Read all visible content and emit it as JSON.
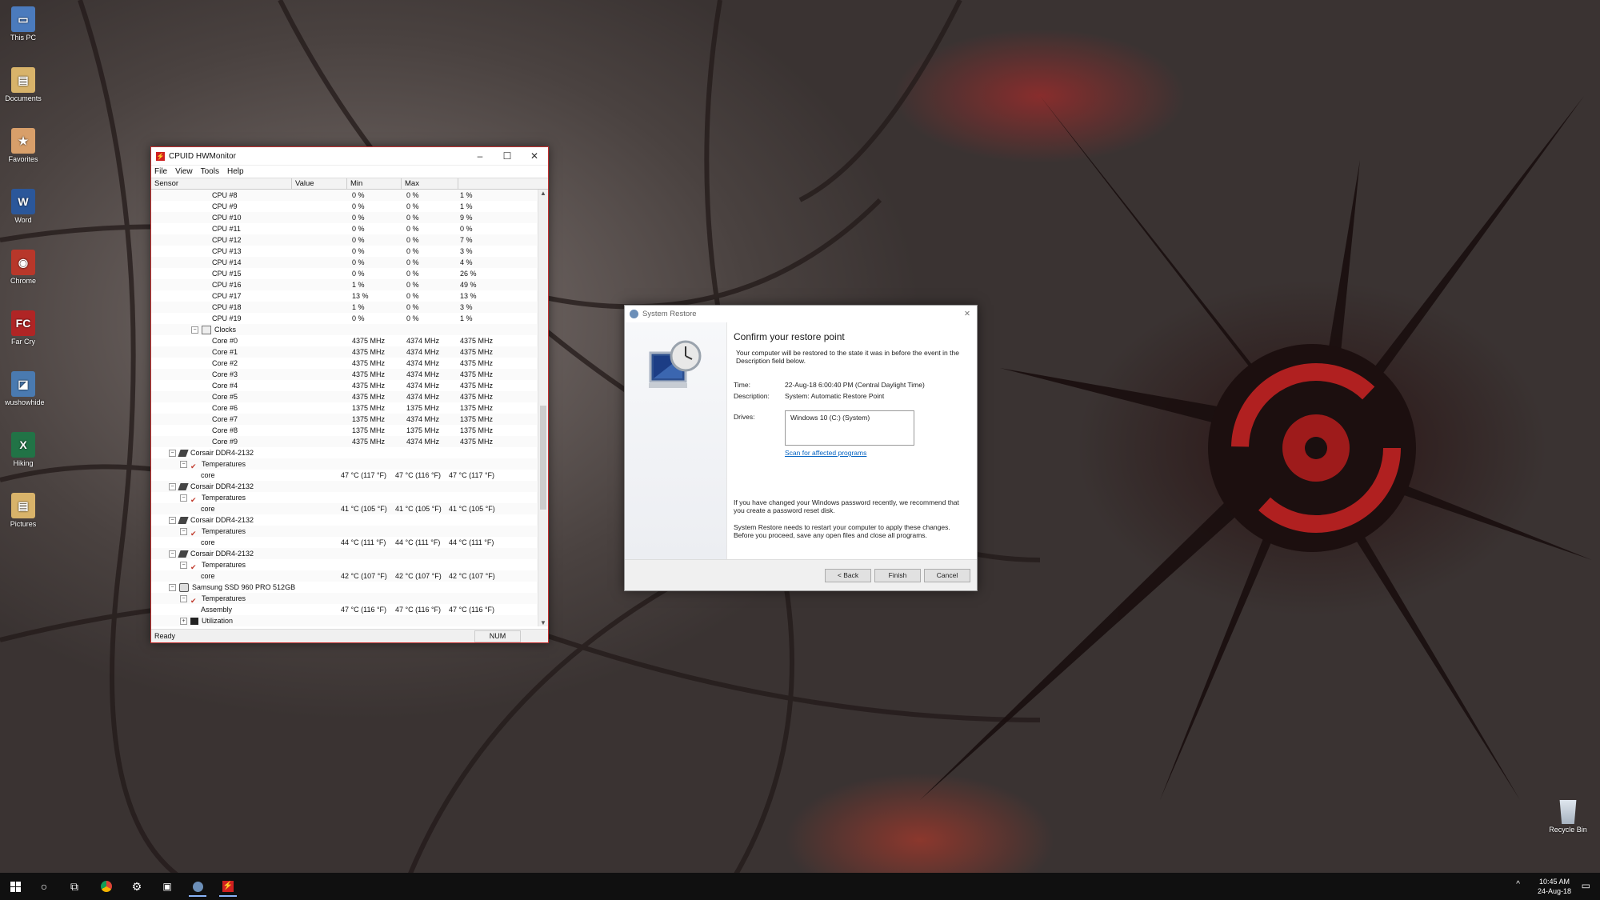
{
  "desktop": {
    "icons": [
      {
        "label": "This PC",
        "icon": "computer-icon",
        "color": "#4b7bbd",
        "glyph": "▭"
      },
      {
        "label": "Documents",
        "icon": "folder-icon",
        "color": "#d8b36a",
        "glyph": "▤"
      },
      {
        "label": "Favorites",
        "icon": "favorites-folder-icon",
        "color": "#d89f6a",
        "glyph": "★"
      },
      {
        "label": "Word",
        "icon": "word-icon",
        "color": "#2b579a",
        "glyph": "W"
      },
      {
        "label": "Chrome",
        "icon": "chrome-icon",
        "color": "#b8372a",
        "glyph": "◉"
      },
      {
        "label": "Far Cry",
        "icon": "farcry-icon",
        "color": "#b02525",
        "glyph": "FC"
      },
      {
        "label": "wushowhide",
        "icon": "troubleshooter-icon",
        "color": "#4a7ab0",
        "glyph": "◪"
      },
      {
        "label": "Hiking",
        "icon": "excel-icon",
        "color": "#217346",
        "glyph": "X"
      },
      {
        "label": "Pictures",
        "icon": "folder-icon",
        "color": "#d8b36a",
        "glyph": "▤"
      }
    ],
    "recycle_bin": "Recycle Bin"
  },
  "hwmonitor": {
    "title": "CPUID HWMonitor",
    "menu": [
      "File",
      "View",
      "Tools",
      "Help"
    ],
    "columns": [
      "Sensor",
      "Value",
      "Min",
      "Max"
    ],
    "status": "Ready",
    "status_num": "NUM",
    "rows": [
      {
        "indent": 3,
        "name": "CPU #8",
        "value": "0 %",
        "min": "0 %",
        "max": "1 %"
      },
      {
        "indent": 3,
        "name": "CPU #9",
        "value": "0 %",
        "min": "0 %",
        "max": "1 %"
      },
      {
        "indent": 3,
        "name": "CPU #10",
        "value": "0 %",
        "min": "0 %",
        "max": "9 %"
      },
      {
        "indent": 3,
        "name": "CPU #11",
        "value": "0 %",
        "min": "0 %",
        "max": "0 %"
      },
      {
        "indent": 3,
        "name": "CPU #12",
        "value": "0 %",
        "min": "0 %",
        "max": "7 %"
      },
      {
        "indent": 3,
        "name": "CPU #13",
        "value": "0 %",
        "min": "0 %",
        "max": "3 %"
      },
      {
        "indent": 3,
        "name": "CPU #14",
        "value": "0 %",
        "min": "0 %",
        "max": "4 %"
      },
      {
        "indent": 3,
        "name": "CPU #15",
        "value": "0 %",
        "min": "0 %",
        "max": "26 %"
      },
      {
        "indent": 3,
        "name": "CPU #16",
        "value": "1 %",
        "min": "0 %",
        "max": "49 %"
      },
      {
        "indent": 3,
        "name": "CPU #17",
        "value": "13 %",
        "min": "0 %",
        "max": "13 %"
      },
      {
        "indent": 3,
        "name": "CPU #18",
        "value": "1 %",
        "min": "0 %",
        "max": "3 %"
      },
      {
        "indent": 3,
        "name": "CPU #19",
        "value": "0 %",
        "min": "0 %",
        "max": "1 %"
      },
      {
        "indent": 2,
        "name": "Clocks",
        "toggle": "−",
        "icon": "clock-sensor",
        "value": "",
        "min": "",
        "max": ""
      },
      {
        "indent": 3,
        "name": "Core #0",
        "value": "4375 MHz",
        "min": "4374 MHz",
        "max": "4375 MHz"
      },
      {
        "indent": 3,
        "name": "Core #1",
        "value": "4375 MHz",
        "min": "4374 MHz",
        "max": "4375 MHz"
      },
      {
        "indent": 3,
        "name": "Core #2",
        "value": "4375 MHz",
        "min": "4374 MHz",
        "max": "4375 MHz"
      },
      {
        "indent": 3,
        "name": "Core #3",
        "value": "4375 MHz",
        "min": "4374 MHz",
        "max": "4375 MHz"
      },
      {
        "indent": 3,
        "name": "Core #4",
        "value": "4375 MHz",
        "min": "4374 MHz",
        "max": "4375 MHz"
      },
      {
        "indent": 3,
        "name": "Core #5",
        "value": "4375 MHz",
        "min": "4374 MHz",
        "max": "4375 MHz"
      },
      {
        "indent": 3,
        "name": "Core #6",
        "value": "1375 MHz",
        "min": "1375 MHz",
        "max": "1375 MHz"
      },
      {
        "indent": 3,
        "name": "Core #7",
        "value": "1375 MHz",
        "min": "4374 MHz",
        "max": "1375 MHz"
      },
      {
        "indent": 3,
        "name": "Core #8",
        "value": "1375 MHz",
        "min": "1375 MHz",
        "max": "1375 MHz"
      },
      {
        "indent": 3,
        "name": "Core #9",
        "value": "4375 MHz",
        "min": "4374 MHz",
        "max": "4375 MHz"
      },
      {
        "indent": 0,
        "name": "Corsair DDR4-2132",
        "toggle": "−",
        "icon": "memory",
        "value": "",
        "min": "",
        "max": ""
      },
      {
        "indent": 1,
        "name": "Temperatures",
        "toggle": "−",
        "icon": "thermometer",
        "value": "",
        "min": "",
        "max": ""
      },
      {
        "indent": 2,
        "name": "core",
        "value": "47 °C  (117 °F)",
        "min": "47 °C  (116 °F)",
        "max": "47 °C  (117 °F)"
      },
      {
        "indent": 0,
        "name": "Corsair DDR4-2132",
        "toggle": "−",
        "icon": "memory",
        "value": "",
        "min": "",
        "max": ""
      },
      {
        "indent": 1,
        "name": "Temperatures",
        "toggle": "−",
        "icon": "thermometer",
        "value": "",
        "min": "",
        "max": ""
      },
      {
        "indent": 2,
        "name": "core",
        "value": "41 °C  (105 °F)",
        "min": "41 °C  (105 °F)",
        "max": "41 °C  (105 °F)"
      },
      {
        "indent": 0,
        "name": "Corsair DDR4-2132",
        "toggle": "−",
        "icon": "memory",
        "value": "",
        "min": "",
        "max": ""
      },
      {
        "indent": 1,
        "name": "Temperatures",
        "toggle": "−",
        "icon": "thermometer",
        "value": "",
        "min": "",
        "max": ""
      },
      {
        "indent": 2,
        "name": "core",
        "value": "44 °C  (111 °F)",
        "min": "44 °C  (111 °F)",
        "max": "44 °C  (111 °F)"
      },
      {
        "indent": 0,
        "name": "Corsair DDR4-2132",
        "toggle": "−",
        "icon": "memory",
        "value": "",
        "min": "",
        "max": ""
      },
      {
        "indent": 1,
        "name": "Temperatures",
        "toggle": "−",
        "icon": "thermometer",
        "value": "",
        "min": "",
        "max": ""
      },
      {
        "indent": 2,
        "name": "core",
        "value": "42 °C  (107 °F)",
        "min": "42 °C  (107 °F)",
        "max": "42 °C  (107 °F)"
      },
      {
        "indent": 0,
        "name": "Samsung SSD 960  PRO 512GB",
        "toggle": "−",
        "icon": "disk",
        "value": "",
        "min": "",
        "max": ""
      },
      {
        "indent": 1,
        "name": "Temperatures",
        "toggle": "−",
        "icon": "thermometer",
        "value": "",
        "min": "",
        "max": ""
      },
      {
        "indent": 2,
        "name": "Assembly",
        "value": "47 °C  (116 °F)",
        "min": "47 °C  (116 °F)",
        "max": "47 °C  (116 °F)"
      },
      {
        "indent": 1,
        "name": "Utilization",
        "toggle": "+",
        "icon": "utilization",
        "value": "",
        "min": "",
        "max": ""
      }
    ]
  },
  "system_restore": {
    "title": "System Restore",
    "heading": "Confirm your restore point",
    "intro": "Your computer will be restored to the state it was in before the event in the Description field below.",
    "time_label": "Time:",
    "time_value": "22-Aug-18 6:00:40 PM (Central Daylight Time)",
    "description_label": "Description:",
    "description_value": "System: Automatic Restore Point",
    "drives_label": "Drives:",
    "drives_value": "Windows 10 (C:) (System)",
    "scan_link": "Scan for affected programs",
    "password_note": "If you have changed your Windows password recently, we recommend that you create a password reset disk.",
    "restart_note": "System Restore needs to restart your computer to apply these changes. Before you proceed, save any open files and close all programs.",
    "back_label": "< Back",
    "finish_label": "Finish",
    "cancel_label": "Cancel"
  },
  "taskbar": {
    "time": "10:45 AM",
    "date": "24-Aug-18"
  }
}
